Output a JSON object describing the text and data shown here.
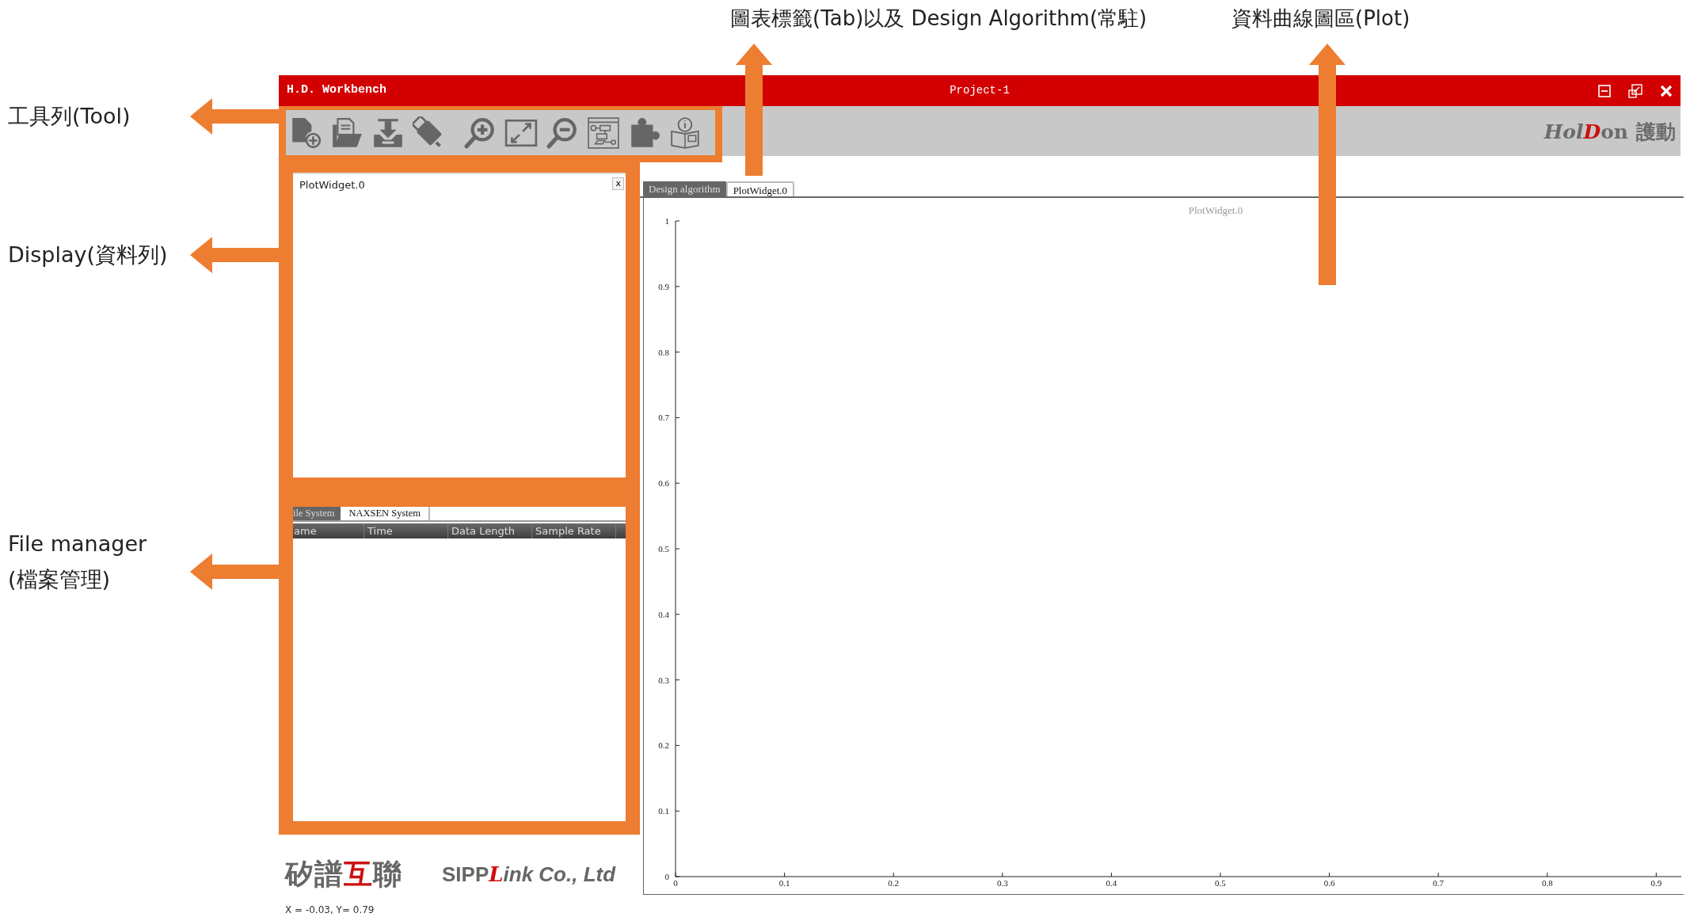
{
  "annotations": {
    "top": [
      {
        "text": "圖表標籤(Tab)以及 Design Algorithm(常駐)"
      },
      {
        "text": "資料曲線圖區(Plot)"
      }
    ],
    "left": [
      {
        "lines": [
          "工具列(Tool)"
        ]
      },
      {
        "lines": [
          "Display(資料列)"
        ]
      },
      {
        "lines": [
          "File manager",
          "(檔案管理)"
        ]
      }
    ]
  },
  "window": {
    "app_name": "H.D. Workbench",
    "title": "Project-1"
  },
  "brand": [
    {
      "text": "Hol",
      "accent": false
    },
    {
      "text": "D",
      "accent": true
    },
    {
      "text": "on",
      "accent": false
    },
    {
      "text": "護動",
      "accent": false
    }
  ],
  "display": {
    "title": "PlotWidget.0",
    "close": "x"
  },
  "file_manager": {
    "tabs": [
      {
        "label": "ile System",
        "selected": false
      },
      {
        "label": "NAXSEN System",
        "selected": true
      }
    ],
    "columns": [
      "ame",
      "Time",
      "Data Length",
      "Sample Rate"
    ]
  },
  "company_cn": [
    {
      "text": "矽譜",
      "accent": false
    },
    {
      "text": "互",
      "accent": true
    },
    {
      "text": "聯",
      "accent": false
    }
  ],
  "company_en": [
    {
      "text": "SIPP",
      "accent": false
    },
    {
      "text": "L",
      "accent": true
    },
    {
      "text": "ink Co., Ltd",
      "accent": false
    }
  ],
  "status_bar": "X = -0.03, Y= 0.79",
  "plot_tabs": [
    {
      "label": "Design algorithm",
      "selected": false
    },
    {
      "label": "PlotWidget.0",
      "selected": true
    }
  ],
  "plot": {
    "chart_data": {
      "type": "line",
      "title": "PlotWidget.0",
      "xlim": [
        0,
        0.923
      ],
      "ylim": [
        0,
        1
      ],
      "xticks": [
        0,
        0.1,
        0.2,
        0.3,
        0.4,
        0.5,
        0.6,
        0.7,
        0.8,
        0.9
      ],
      "yticks": [
        0,
        0.1,
        0.2,
        0.3,
        0.4,
        0.5,
        0.6,
        0.7,
        0.8,
        0.9,
        1
      ]
    }
  }
}
